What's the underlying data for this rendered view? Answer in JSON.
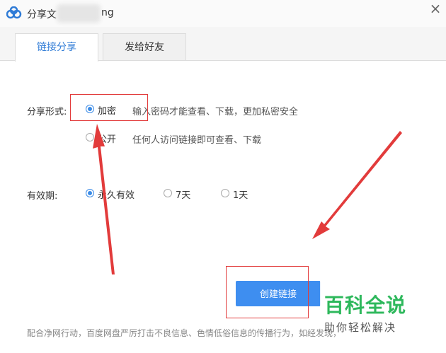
{
  "window": {
    "title_prefix": "分享文",
    "title_suffix": "ng",
    "close_label": "×"
  },
  "tabs": [
    {
      "label": "链接分享",
      "active": true
    },
    {
      "label": "发给好友",
      "active": false
    }
  ],
  "share_form": {
    "label": "分享形式:",
    "options": [
      {
        "label": "加密",
        "desc": "输入密码才能查看、下载，更加私密安全",
        "checked": true
      },
      {
        "label": "公开",
        "desc": "任何人访问链接即可查看、下载",
        "checked": false
      }
    ]
  },
  "validity": {
    "label": "有效期:",
    "options": [
      {
        "label": "永久有效",
        "checked": true
      },
      {
        "label": "7天",
        "checked": false
      },
      {
        "label": "1天",
        "checked": false
      }
    ]
  },
  "create_button": "创建链接",
  "footer": "配合净网行动，百度网盘严厉打击不良信息、色情低俗信息的传播行为，如经发现，",
  "watermark": {
    "main": "百科全说",
    "sub": "助你轻松解决"
  },
  "colors": {
    "accent": "#3e8ef0",
    "annotation": "#e23b3b",
    "watermark": "#2eb85c"
  }
}
